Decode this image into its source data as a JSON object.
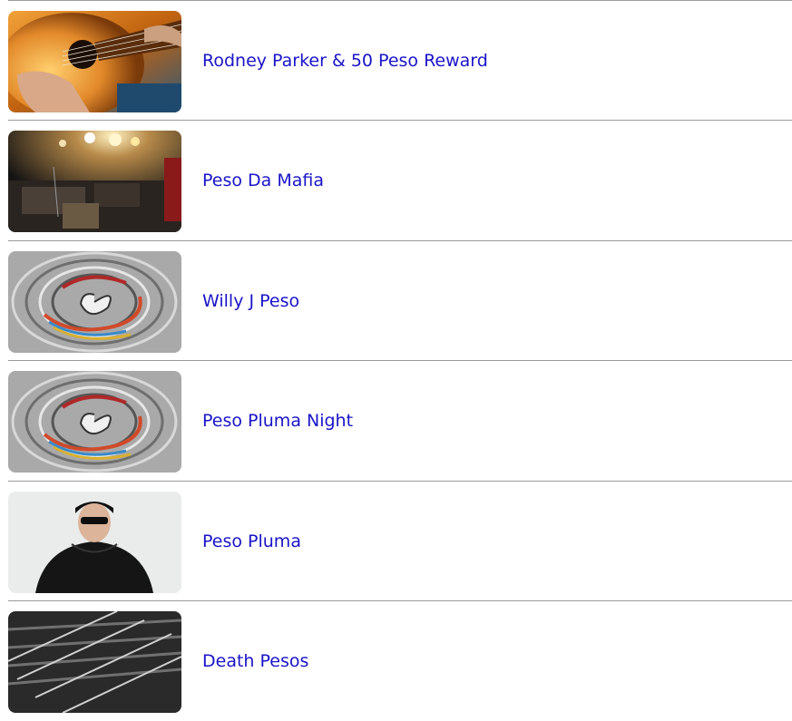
{
  "results": [
    {
      "name": "Rodney Parker & 50 Peso Reward",
      "image": "acoustic-guitar-photo"
    },
    {
      "name": "Peso Da Mafia",
      "image": "concert-stage-photo"
    },
    {
      "name": "Willy J Peso",
      "image": "swirl-placeholder-image"
    },
    {
      "name": "Peso Pluma Night",
      "image": "swirl-placeholder-image"
    },
    {
      "name": "Peso Pluma",
      "image": "artist-portrait-photo"
    },
    {
      "name": "Death Pesos",
      "image": "guitar-strings-photo"
    }
  ],
  "colors": {
    "link": "#1a14c8",
    "divider": "#9a9a9a"
  }
}
